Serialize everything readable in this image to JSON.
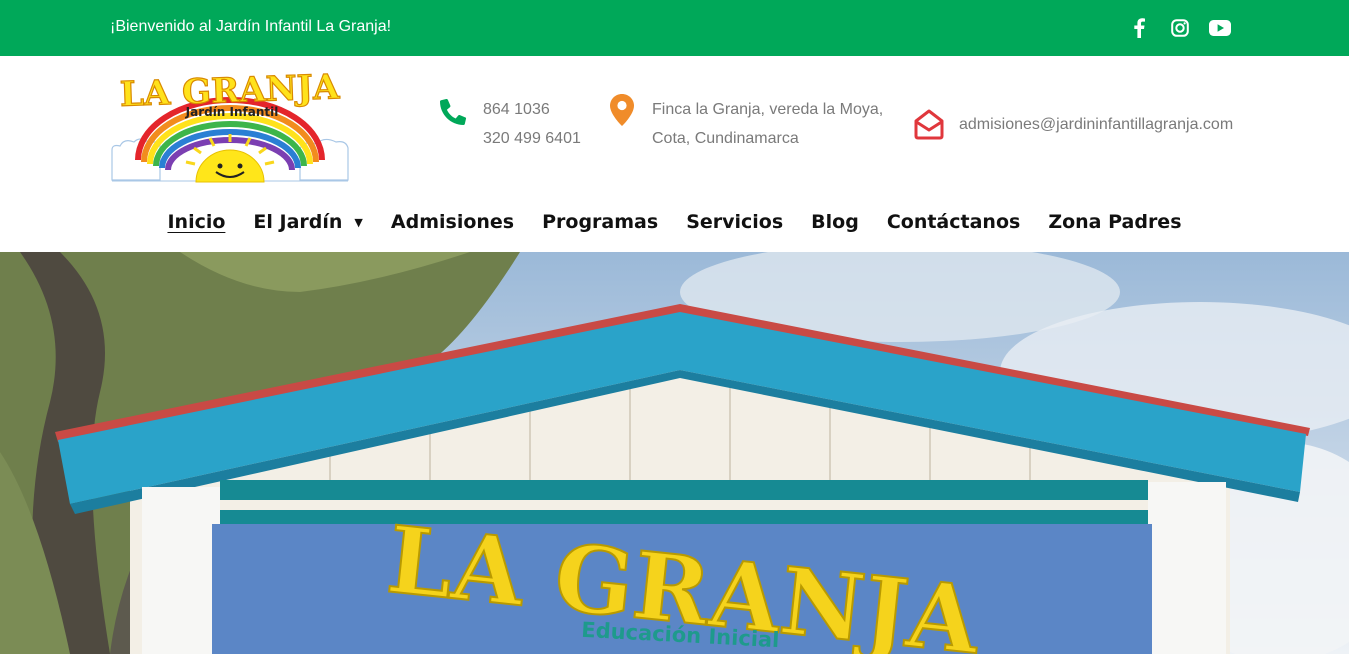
{
  "topbar": {
    "welcome": "¡Bienvenido al Jardín Infantil La Granja!",
    "background": "#00a859",
    "social": [
      {
        "icon": "facebook-icon"
      },
      {
        "icon": "instagram-icon"
      },
      {
        "icon": "youtube-icon"
      }
    ]
  },
  "logo": {
    "title": "LA GRANJA",
    "subtitle": "Jardín Infantil"
  },
  "contact": {
    "phone1": "864 1036",
    "phone2": "320 499 6401",
    "address1": "Finca la Granja, vereda la Moya,",
    "address2": "Cota, Cundinamarca",
    "email": "admisiones@jardininfantillagranja.com",
    "icons": {
      "phone": "#00a859",
      "location": "#f08c2a",
      "email": "#e0373c"
    }
  },
  "nav": {
    "items": [
      {
        "label": "Inicio",
        "active": true
      },
      {
        "label": "El Jardín",
        "dropdown": true
      },
      {
        "label": "Admisiones"
      },
      {
        "label": "Programas"
      },
      {
        "label": "Servicios"
      },
      {
        "label": "Blog"
      },
      {
        "label": "Contáctanos"
      },
      {
        "label": "Zona Padres"
      }
    ]
  },
  "hero": {
    "sign_title": "LA GRANJA",
    "sign_subtitle": "Educación Inicial"
  }
}
